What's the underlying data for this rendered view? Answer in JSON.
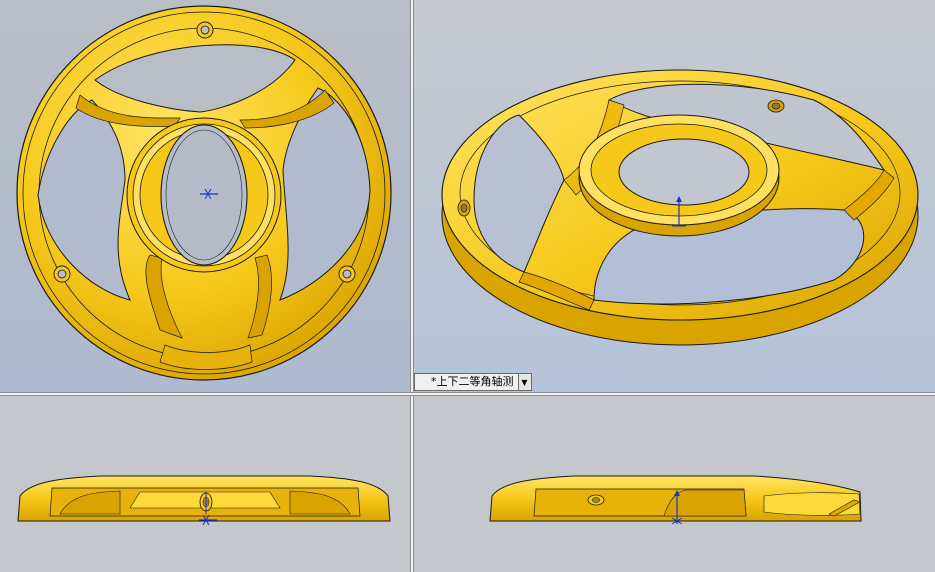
{
  "viewports": {
    "front": {
      "background_top": "#b9bdc6",
      "background_bottom": "#aebad0"
    },
    "isometric": {
      "background_top": "#c5c8ce",
      "background_bottom": "#b5c3d9"
    },
    "top": {
      "background_top": "#c4c7cc",
      "background_bottom": "#c1c5cd"
    },
    "right": {
      "background_top": "#c4c7cc",
      "background_bottom": "#c1c5cd"
    }
  },
  "view_selector": {
    "label": "*上下二等角轴测",
    "dropdown_icon": "chevron-down-icon"
  },
  "colors": {
    "part_fill": "#f6c81a",
    "part_light": "#ffe565",
    "part_shadow": "#d9a300",
    "edge": "#1a1a1a",
    "axis_blue": "#1f2fd6"
  }
}
